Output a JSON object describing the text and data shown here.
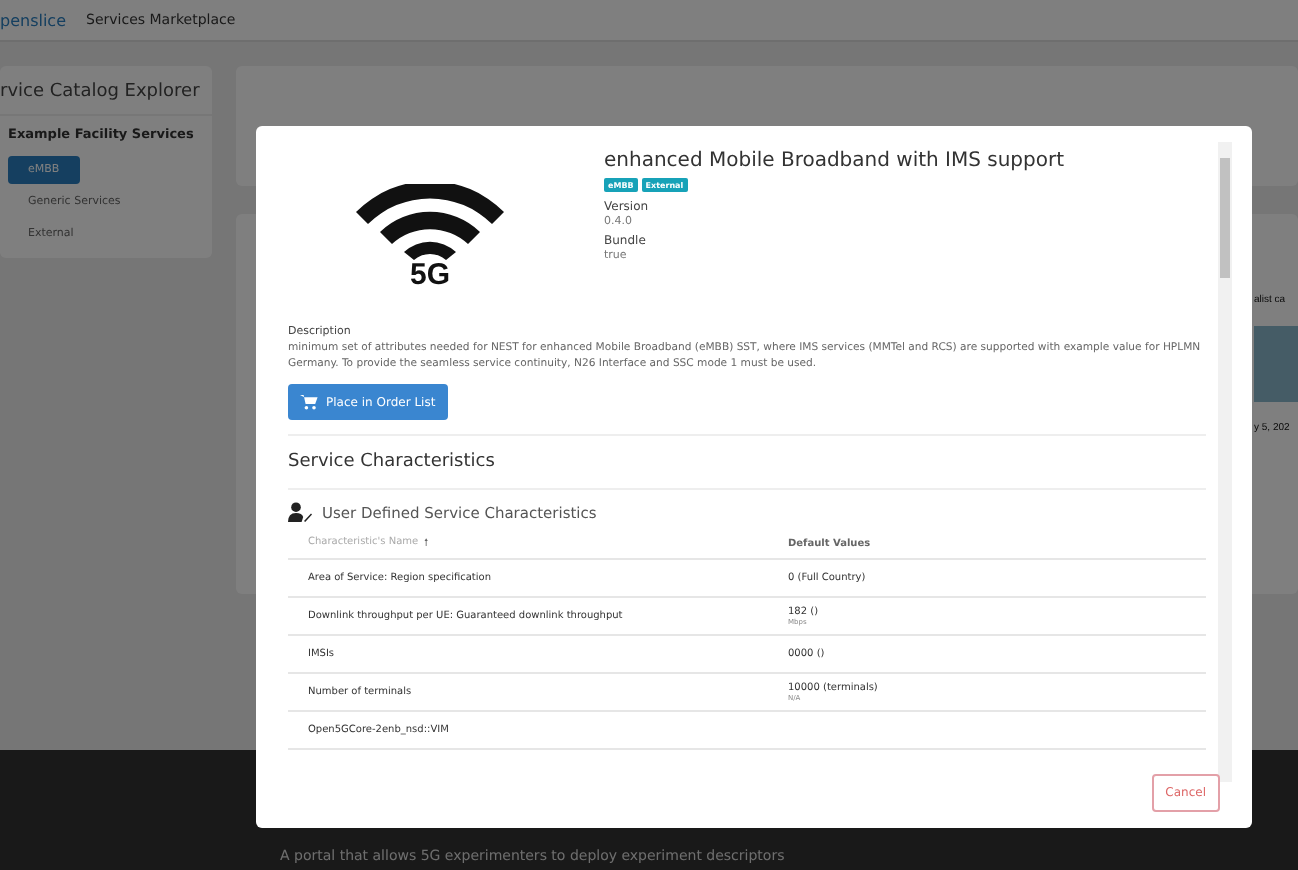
{
  "header": {
    "logo": "penslice",
    "title": "Services Marketplace"
  },
  "sidebar": {
    "title": "rvice Catalog Explorer",
    "group": "Example Facility Services",
    "items": [
      {
        "label": "eMBB",
        "selected": true
      },
      {
        "label": "Generic Services",
        "selected": false
      },
      {
        "label": "External",
        "selected": false
      }
    ]
  },
  "background_fragments": {
    "card_text": "alist ca",
    "card_date": "y 5, 202"
  },
  "footer": {
    "description": "A portal that allows 5G experimenters to deploy experiment descriptors"
  },
  "modal": {
    "title": "enhanced Mobile Broadband with IMS support",
    "image_label": "5G",
    "tags": [
      "eMBB",
      "External"
    ],
    "fields": [
      {
        "label": "Version",
        "value": "0.4.0"
      },
      {
        "label": "Bundle",
        "value": "true"
      }
    ],
    "description_label": "Description",
    "description": "minimum set of attributes needed for NEST for enhanced Mobile Broadband (eMBB) SST, where IMS services (MMTel and RCS) are supported with example value for HPLMN Germany. To provide the seamless service continuity, N26 Interface and SSC mode 1 must be used.",
    "order_button": "Place in Order List",
    "section_title": "Service Characteristics",
    "subsection_title": "User Defined Service Characteristics",
    "table": {
      "columns": [
        {
          "label": "Characteristic's Name",
          "sort_arrow": "🠕"
        },
        {
          "label": "Default Values"
        }
      ],
      "rows": [
        {
          "name": "Area of Service: Region specification",
          "value": "0 (Full Country)"
        },
        {
          "name": "Downlink throughput per UE: Guaranteed downlink throughput",
          "value": "182 ()",
          "unit": "Mbps"
        },
        {
          "name": "IMSIs",
          "value": "0000 ()"
        },
        {
          "name": "Number of terminals",
          "value": "10000 (terminals)",
          "unit": "N/A"
        },
        {
          "name": "Open5GCore-2enb_nsd::VIM"
        }
      ]
    },
    "cancel_button": "Cancel"
  }
}
